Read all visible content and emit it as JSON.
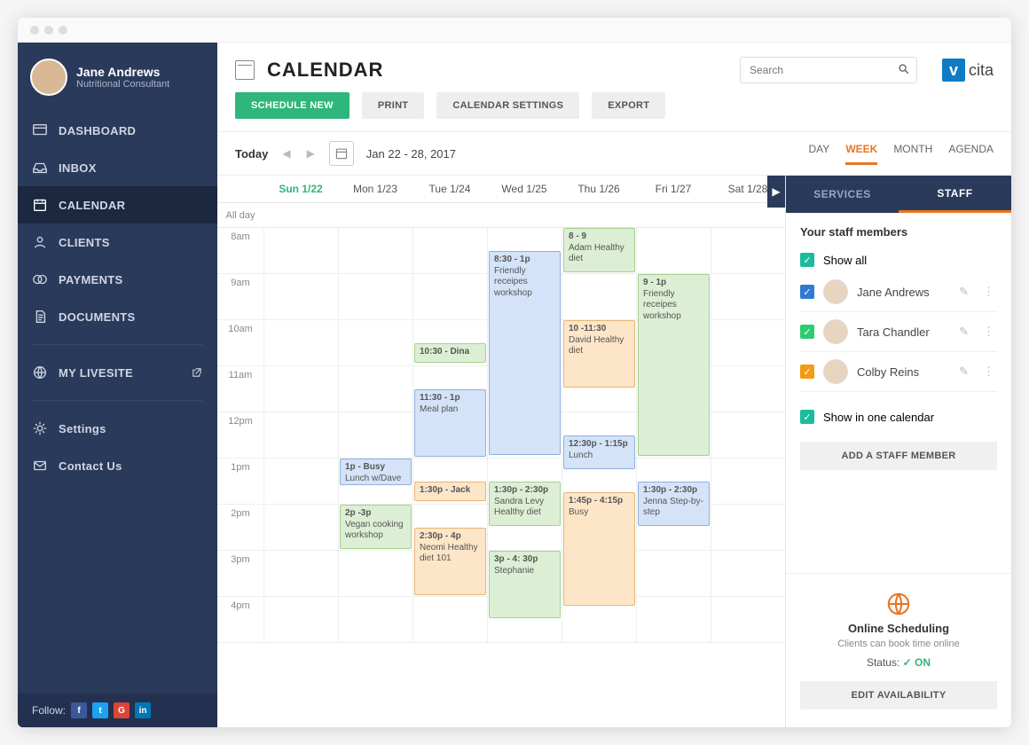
{
  "profile": {
    "name": "Jane Andrews",
    "role": "Nutritional Consultant"
  },
  "nav": {
    "dashboard": "DASHBOARD",
    "inbox": "INBOX",
    "calendar": "CALENDAR",
    "clients": "CLIENTS",
    "payments": "PAYMENTS",
    "documents": "DOCUMENTS",
    "livesite": "MY LIVESITE",
    "settings": "Settings",
    "contact": "Contact Us"
  },
  "follow": "Follow:",
  "page": {
    "title": "CALENDAR"
  },
  "search": {
    "placeholder": "Search"
  },
  "logo": "cita",
  "actions": {
    "schedule": "SCHEDULE NEW",
    "print": "PRINT",
    "settings": "CALENDAR SETTINGS",
    "export": "EXPORT"
  },
  "calbar": {
    "today": "Today",
    "range": "Jan 22 - 28, 2017",
    "day": "DAY",
    "week": "WEEK",
    "month": "MONTH",
    "agenda": "AGENDA"
  },
  "days": {
    "allday": "All day",
    "sun": "Sun 1/22",
    "mon": "Mon 1/23",
    "tue": "Tue 1/24",
    "wed": "Wed 1/25",
    "thu": "Thu 1/26",
    "fri": "Fri 1/27",
    "sat": "Sat 1/28"
  },
  "hours": {
    "h8": "8am",
    "h9": "9am",
    "h10": "10am",
    "h11": "11am",
    "h12": "12pm",
    "h13": "1pm",
    "h14": "2pm",
    "h15": "3pm",
    "h16": "4pm"
  },
  "events": {
    "mon_1p": {
      "t": "1p - Busy",
      "d": "Lunch w/Dave"
    },
    "mon_2p": {
      "t": "2p -3p",
      "d": "Vegan cooking workshop"
    },
    "tue_1030": {
      "t": "10:30 - Dina"
    },
    "tue_1130": {
      "t": "11:30 - 1p",
      "d": "Meal plan"
    },
    "tue_130": {
      "t": "1:30p - Jack"
    },
    "tue_230": {
      "t": "2:30p - 4p",
      "d": "Neomi Healthy diet 101"
    },
    "wed_830": {
      "t": "8:30 - 1p",
      "d": "Friendly receipes workshop"
    },
    "wed_130": {
      "t": "1:30p - 2:30p",
      "d": "Sandra Levy Healthy diet"
    },
    "wed_3p": {
      "t": "3p - 4: 30p",
      "d": "Stephanie"
    },
    "thu_8": {
      "t": "8 - 9",
      "d": "Adam Healthy diet"
    },
    "thu_10": {
      "t": "10 -11:30",
      "d": "David Healthy diet"
    },
    "thu_1230": {
      "t": "12:30p - 1:15p",
      "d": "Lunch"
    },
    "thu_145": {
      "t": "1:45p - 4:15p",
      "d": "Busy"
    },
    "fri_9": {
      "t": "9 - 1p",
      "d": "Friendly receipes workshop"
    },
    "fri_130": {
      "t": "1:30p - 2:30p",
      "d": "Jenna Step-by-step"
    }
  },
  "panel": {
    "services": "SERVICES",
    "staff": "STAFF",
    "title": "Your staff members",
    "showall": "Show all",
    "showone": "Show in one calendar",
    "members": {
      "jane": "Jane Andrews",
      "tara": "Tara Chandler",
      "colby": "Colby Reins"
    },
    "add": "ADD A STAFF MEMBER",
    "sched": {
      "title": "Online Scheduling",
      "sub": "Clients can book time online",
      "status": "Status:",
      "on": "ON",
      "edit": "EDIT AVAILABILITY"
    }
  }
}
